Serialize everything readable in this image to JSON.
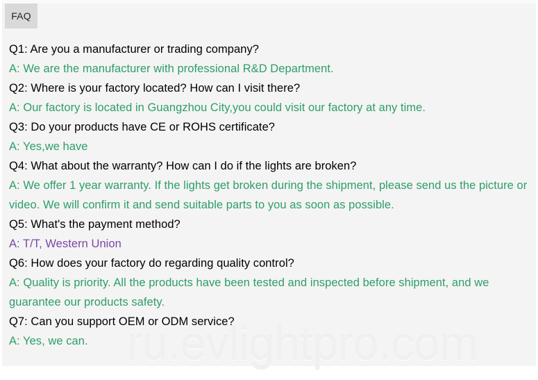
{
  "tab": {
    "label": "FAQ"
  },
  "watermark": {
    "text": "ru.evlightpro.com"
  },
  "colors": {
    "question": "#000000",
    "answer_green": "#2e9e68",
    "answer_purple": "#7c45a6",
    "panel_background": "#f4f4f4",
    "tab_background": "#d9d9d9",
    "watermark": "#f0f0f0"
  },
  "faq": {
    "entries": [
      {
        "question": "Q1: Are you a manufacturer or trading company?",
        "answer": "A: We are the manufacturer with professional R&D Department.",
        "answer_color": "green"
      },
      {
        "question": "Q2: Where is your factory located? How can I visit there?",
        "answer": "A: Our factory is located in Guangzhou City,you could visit our factory at any time.",
        "answer_color": "green"
      },
      {
        "question": "Q3: Do your products have CE or ROHS certificate?",
        "answer": "A: Yes,we have",
        "answer_color": "green"
      },
      {
        "question": "Q4: What about the warranty? How can I do if the lights are broken?",
        "answer": "A: We offer 1 year warranty. If the lights get broken during the shipment, please send us the picture or video. We will confirm it and send suitable parts to you as soon as possible.",
        "answer_color": "green"
      },
      {
        "question": "Q5: What's the payment method?",
        "answer": "A: T/T, Western Union",
        "answer_color": "purple"
      },
      {
        "question": "Q6: How does your factory do regarding quality control?",
        "answer": "A: Quality is priority. All the products have been tested and inspected before shipment, and we guarantee our products safety.",
        "answer_color": "green"
      },
      {
        "question": "Q7: Can you support OEM or ODM service?",
        "answer": "A: Yes, we can.",
        "answer_color": "green"
      }
    ]
  }
}
